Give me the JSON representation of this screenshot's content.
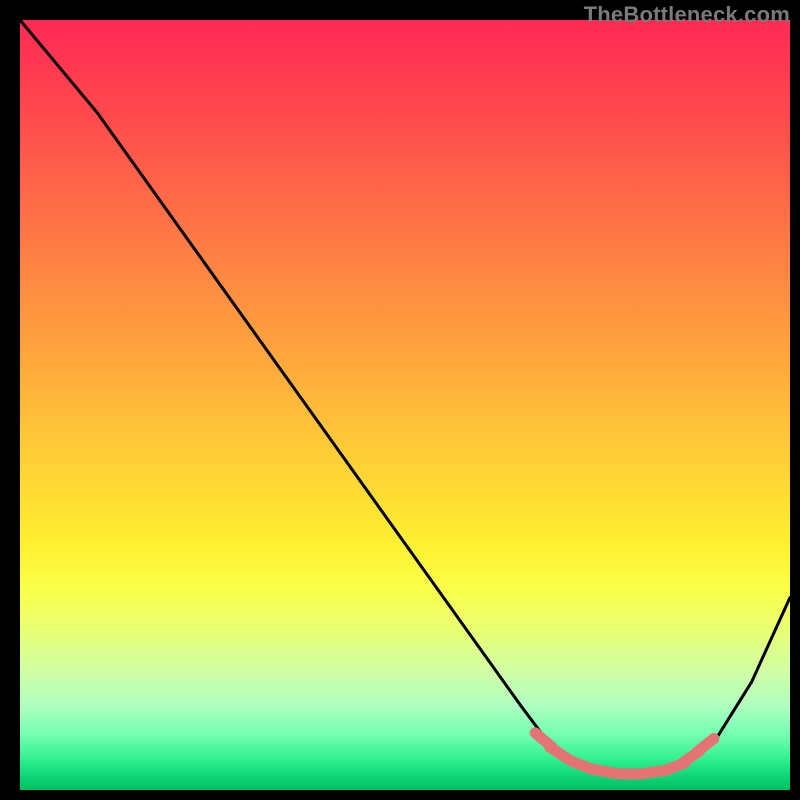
{
  "watermark": "TheBottleneck.com",
  "chart_data": {
    "type": "line",
    "title": "",
    "xlabel": "",
    "ylabel": "",
    "xlim": [
      0,
      100
    ],
    "ylim": [
      0,
      100
    ],
    "series": [
      {
        "name": "bottleneck-curve",
        "x": [
          0,
          5,
          10,
          15,
          20,
          25,
          30,
          35,
          40,
          45,
          50,
          55,
          60,
          65,
          68,
          70,
          73,
          76,
          80,
          83,
          86,
          90,
          95,
          100
        ],
        "y": [
          100,
          94,
          88,
          81,
          74,
          67,
          60,
          53,
          46,
          39,
          32,
          25,
          18,
          11,
          7,
          5,
          3,
          2,
          2,
          2,
          3,
          6,
          14,
          25
        ]
      }
    ],
    "markers": {
      "name": "optimal-range",
      "points": [
        {
          "x": 68,
          "y": 6.5
        },
        {
          "x": 70,
          "y": 4.8
        },
        {
          "x": 73,
          "y": 3.2
        },
        {
          "x": 76,
          "y": 2.4
        },
        {
          "x": 79,
          "y": 2.1
        },
        {
          "x": 82,
          "y": 2.3
        },
        {
          "x": 85,
          "y": 3.0
        },
        {
          "x": 87,
          "y": 4.2
        },
        {
          "x": 89,
          "y": 5.8
        }
      ]
    },
    "colors": {
      "curve": "#000000",
      "marker": "#e57373",
      "gradient_top": "#ff2a55",
      "gradient_bottom": "#00c060"
    }
  }
}
